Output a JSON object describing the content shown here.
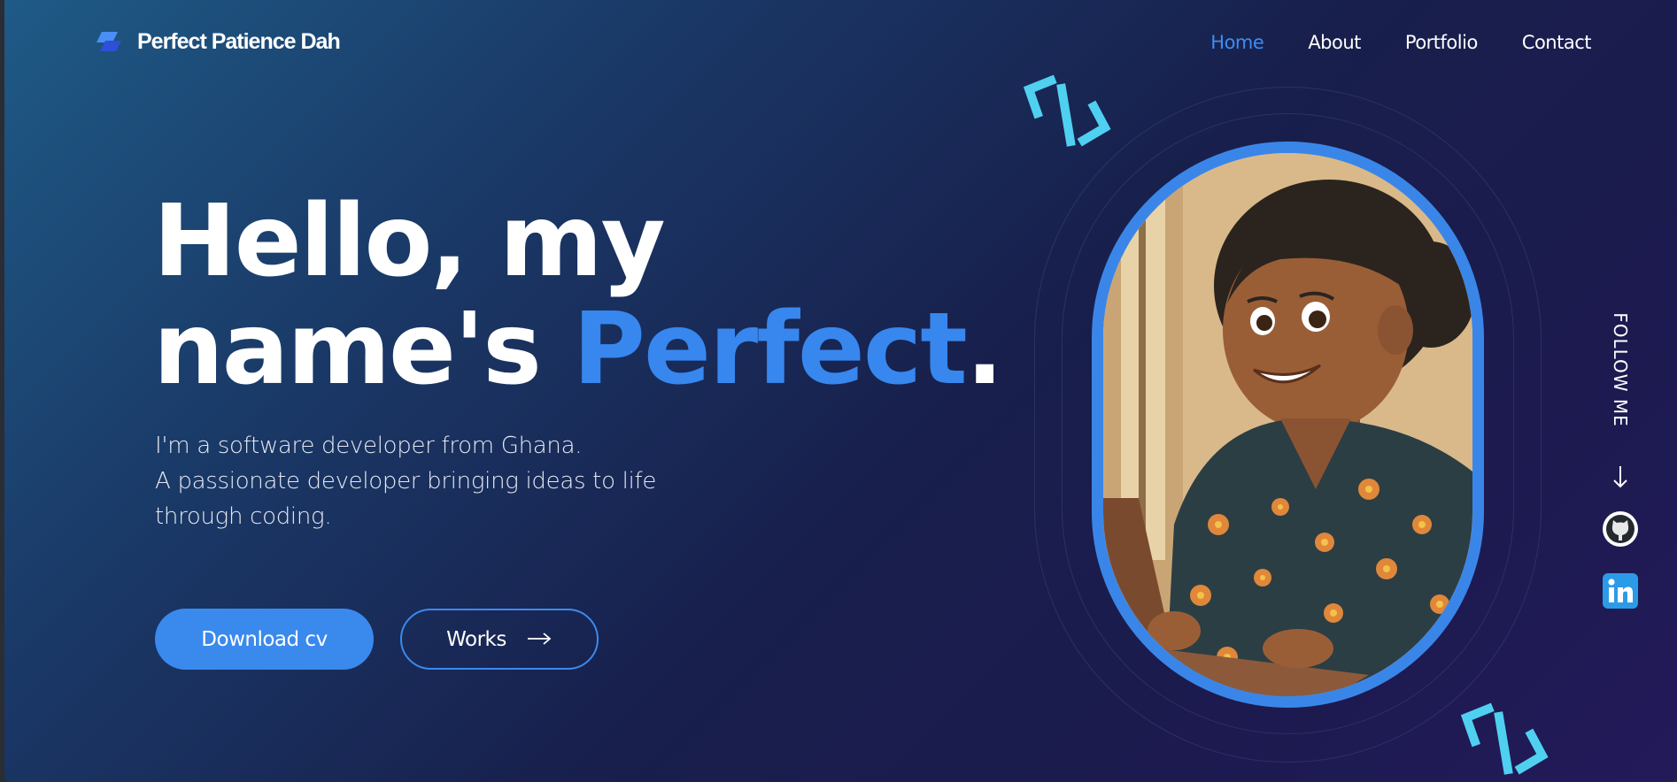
{
  "brand": {
    "name": "Perfect Patience Dah",
    "logo_icon": "layers-logo-icon"
  },
  "nav": {
    "items": [
      {
        "label": "Home",
        "active": true
      },
      {
        "label": "About",
        "active": false
      },
      {
        "label": "Portfolio",
        "active": false
      },
      {
        "label": "Contact",
        "active": false
      }
    ]
  },
  "hero": {
    "line1": "Hello, my",
    "line2_prefix": "name's ",
    "line2_accent": "Perfect",
    "line2_suffix": ".",
    "subtitle": [
      "I'm a software developer from Ghana.",
      "A passionate developer bringing ideas to life",
      "through coding."
    ],
    "primary_button": "Download cv",
    "secondary_button": "Works",
    "secondary_icon": "arrow-right-icon"
  },
  "portrait": {
    "subject": "illustrated-developer-portrait"
  },
  "follow": {
    "label": "FOLLOW ME",
    "arrow_icon": "arrow-down-icon",
    "socials": [
      {
        "name": "github-icon"
      },
      {
        "name": "linkedin-icon"
      }
    ]
  },
  "colors": {
    "accent": "#3a8aee",
    "code_mark": "#4fd0f0",
    "text": "#ffffff"
  }
}
